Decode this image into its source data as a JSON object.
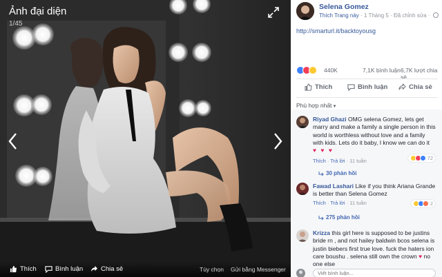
{
  "viewer": {
    "album_title": "Ảnh đại diện",
    "photo_counter": "1/45",
    "bottom_bar": {
      "like": "Thích",
      "comment": "Bình luận",
      "share": "Chia sẻ",
      "options": "Tùy chọn",
      "send_messenger": "Gửi bằng Messenger"
    }
  },
  "post": {
    "page_name": "Selena Gomez",
    "like_page": "Thích Trang này",
    "date": "1 Tháng 5",
    "edited": "Đã chỉnh sửa",
    "link": "http://smarturl.it/backtoyousg",
    "reaction_count": "440K",
    "comment_count": "7,1K bình luận",
    "share_count": "6,7K lượt chia sẻ",
    "actions": {
      "like": "Thích",
      "comment": "Bình luận",
      "share": "Chia sẻ"
    },
    "sort_label": "Phù hợp nhất"
  },
  "comments": [
    {
      "author": "Riyad Ghazi",
      "text": "OMG selena Gomez, lets get marry and make a family a single person in this world is worthless without love and a family with kids. Lets do it baby, I know we can do it",
      "hearts": "♥ ♥ ♥",
      "like": "Thích",
      "reply": "Trả lời",
      "time": "11 tuần",
      "reaction_count": "72",
      "replies": "30 phản hồi"
    },
    {
      "author": "Fawad Lashari",
      "text": "Like if you think Ariana Grande is better than Selena Gomez",
      "like": "Thích",
      "reply": "Trả lời",
      "time": "11 tuần",
      "reaction_count": "2",
      "replies": "275 phản hồi"
    },
    {
      "author": "Krizza",
      "text": "this girl here is supposed to be justins bride rn , and not hailey baldwin bcos selena is justin biebers first true love. fuck the haters ion care boushu . selena still own the crown",
      "text_tail": "no one else"
    }
  ],
  "write_comment_placeholder": "Viết bình luận...",
  "colors": {
    "link_blue": "#365899",
    "action_blue": "#4267b2",
    "like_blue": "#4080ff",
    "love_red": "#f33e58",
    "wow_yellow": "#fcc933"
  }
}
